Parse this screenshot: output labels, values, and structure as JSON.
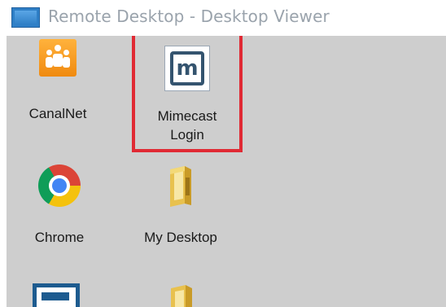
{
  "window": {
    "title": "Remote Desktop - Desktop Viewer",
    "icon": "remote-desktop-icon"
  },
  "desktop": {
    "icons": [
      {
        "id": "canalnet",
        "label": "CanalNet",
        "icon": "canalnet-app-icon"
      },
      {
        "id": "mimecast",
        "label_line1": "Mimecast",
        "label_line2": "Login",
        "icon": "mimecast-app-icon",
        "highlighted": true
      },
      {
        "id": "chrome",
        "label": "Chrome",
        "icon": "chrome-icon"
      },
      {
        "id": "my-desktop",
        "label": "My Desktop",
        "icon": "folder-icon"
      },
      {
        "id": "partial-app",
        "label": "",
        "icon": "app-icon"
      },
      {
        "id": "partial-folder",
        "label": "",
        "icon": "folder-icon"
      }
    ]
  },
  "colors": {
    "desktop_background": "#cecece",
    "highlight_border": "#e02a34",
    "title_text": "#9aa3ac",
    "mimecast_brand": "#34546f",
    "canalnet_brand": "#f08a10"
  }
}
